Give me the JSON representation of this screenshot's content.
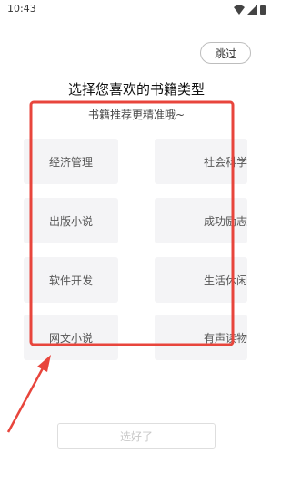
{
  "status_bar": {
    "time": "10:43"
  },
  "skip_label": "跳过",
  "title": "选择您喜欢的书籍类型",
  "subtitle": "书籍推荐更精准哦~",
  "categories": [
    {
      "label": "经济管理"
    },
    {
      "label": "社会科学"
    },
    {
      "label": "出版小说"
    },
    {
      "label": "成功励志"
    },
    {
      "label": "软件开发"
    },
    {
      "label": "生活休闲"
    },
    {
      "label": "网文小说"
    },
    {
      "label": "有声读物"
    }
  ],
  "done_label": "选好了",
  "colors": {
    "highlight": "#e8453c",
    "tile_bg": "#f4f4f6",
    "disabled_text": "#c8c8c8"
  }
}
